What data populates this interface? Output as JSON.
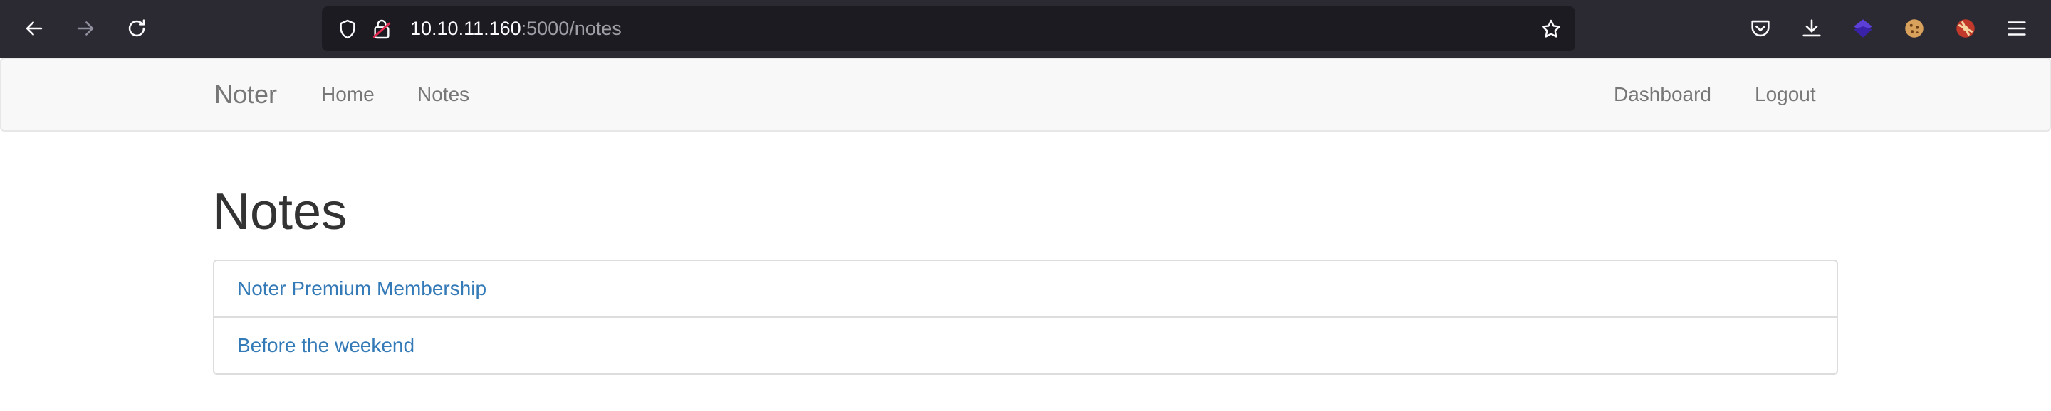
{
  "browser": {
    "url_host": "10.10.11.160",
    "url_rest": ":5000/notes",
    "icons": [
      "back-icon",
      "forward-icon",
      "reload-icon",
      "shield-icon",
      "insecure-lock-icon",
      "bookmark-star-icon",
      "pocket-icon",
      "download-icon",
      "extension-icon",
      "cookie-icon",
      "avatar-icon",
      "menu-icon"
    ]
  },
  "navbar": {
    "brand": "Noter",
    "left_links": [
      "Home",
      "Notes"
    ],
    "right_links": [
      "Dashboard",
      "Logout"
    ]
  },
  "main": {
    "title": "Notes",
    "notes": [
      "Noter Premium Membership",
      "Before the weekend"
    ]
  },
  "colors": {
    "chrome_bg": "#2b2a33",
    "urlbar_bg": "#1c1b22",
    "navbar_bg": "#f8f8f8",
    "link": "#337ab7",
    "heading": "#333333"
  }
}
